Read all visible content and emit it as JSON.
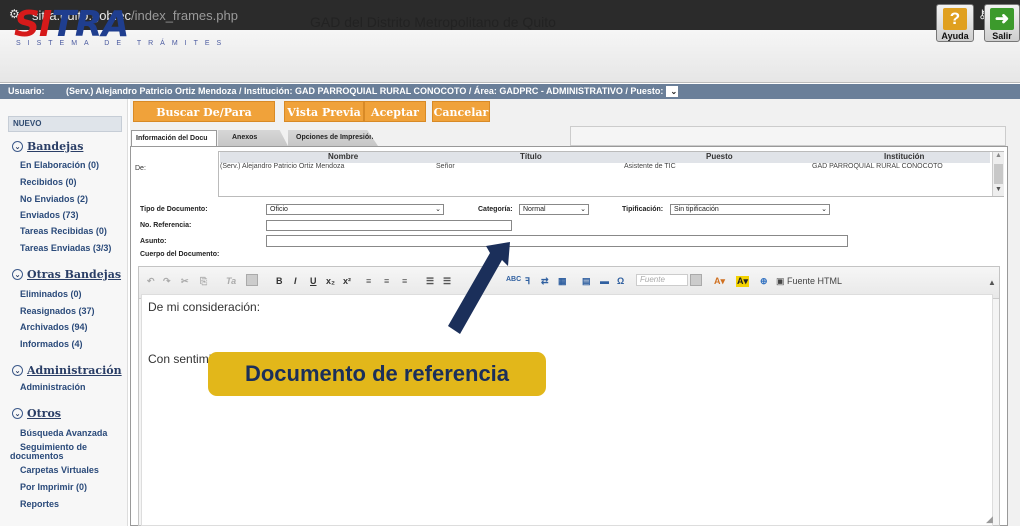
{
  "browser": {
    "domain": "sitra.quito.gob.ec",
    "path": "/index_frames.php"
  },
  "header": {
    "logo_main": "SITRA",
    "logo_sub": "SISTEMA DE TRÁMITES",
    "title": "GAD del Distrito Metropolitano de Quito",
    "help_label": "Ayuda",
    "exit_label": "Salir"
  },
  "userbar": {
    "label": "Usuario:",
    "value": "(Serv.) Alejandro Patricio Ortiz Mendoza / Institución: GAD PARROQUIAL RURAL CONOCOTO / Área: GADPRC - ADMINISTRATIVO / Puesto:"
  },
  "sidebar": {
    "nuevo": "NUEVO",
    "bandejas": {
      "title": "Bandejas",
      "items": [
        "En Elaboración (0)",
        "Recibidos (0)",
        "No Enviados (2)",
        "Enviados (73)",
        "Tareas Recibidas (0)",
        "Tareas Enviadas (3/3)"
      ]
    },
    "otras": {
      "title": "Otras Bandejas",
      "items": [
        "Eliminados (0)",
        "Reasignados (37)",
        "Archivados (94)",
        "Informados (4)"
      ]
    },
    "admin": {
      "title": "Administración",
      "items": [
        "Administración"
      ]
    },
    "otros": {
      "title": "Otros",
      "items": [
        "Búsqueda Avanzada",
        "Seguimiento de",
        "documentos",
        "Carpetas Virtuales",
        "Por Imprimir (0)",
        "Reportes"
      ]
    }
  },
  "actions": {
    "buscar": "Buscar De/Para",
    "vista": "Vista Previa",
    "aceptar": "Aceptar",
    "cancelar": "Cancelar"
  },
  "tabs": [
    "Información del Docu",
    "Anexos",
    "Opciones de Impresión"
  ],
  "grid": {
    "headers": [
      "Nombre",
      "Título",
      "Puesto",
      "Institución"
    ],
    "de_label": "De:",
    "row": [
      "(Serv.) Alejandro Patricio Ortiz Mendoza",
      "Señor",
      "Asistente de TIC",
      "GAD PARROQUIAL RURAL CONOCOTO"
    ]
  },
  "form": {
    "tipo_label": "Tipo de Documento:",
    "tipo_value": "Oficio",
    "categoria_label": "Categoría:",
    "categoria_value": "Normal",
    "tipificacion_label": "Tipificación:",
    "tipificacion_value": "Sin tipificación",
    "referencia_label": "No. Referencia:",
    "asunto_label": "Asunto:",
    "cuerpo_label": "Cuerpo del Documento:"
  },
  "editor": {
    "font_placeholder": "Fuente",
    "html_label": "Fuente HTML",
    "line1": "De mi consideración:",
    "line2": "Con sentimientos de distinguida consideración."
  },
  "annotation": {
    "label": "Documento de referencia"
  },
  "colors": {
    "accent_orange": "#f0a23a",
    "userbar": "#6a7f99",
    "badge": "#e2b71a",
    "arrow": "#1b2f5a"
  }
}
